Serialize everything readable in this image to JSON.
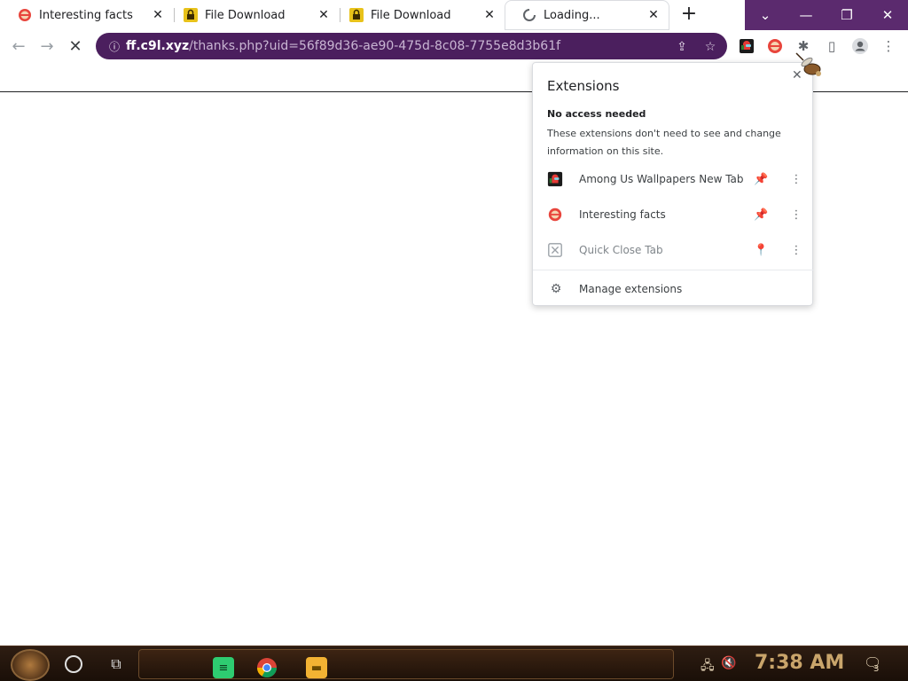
{
  "tabs": [
    {
      "title": "Interesting facts",
      "close": "✕"
    },
    {
      "title": "File Download",
      "close": "✕"
    },
    {
      "title": "File Download",
      "close": "✕"
    },
    {
      "title": "Loading...",
      "close": "✕"
    }
  ],
  "new_tab": "+",
  "window_controls": {
    "tab_search": "⌄",
    "minimize": "—",
    "restore": "❐",
    "close": "✕"
  },
  "toolbar": {
    "back": "←",
    "forward": "→",
    "stop": "✕",
    "url_host": "ff.c9l.xyz",
    "url_path": "/thanks.php?uid=56f89d36-ae90-475d-8c08-7755e8d3b61f",
    "share": "⇪",
    "bookmark": "☆",
    "extensions": "✱",
    "side_panel": "▯",
    "profile": "●",
    "menu": "⋮"
  },
  "extensions_popup": {
    "title": "Extensions",
    "close": "✕",
    "section_heading": "No access needed",
    "section_description": "These extensions don't need to see and change information on this site.",
    "items": [
      {
        "name": "Among Us Wallpapers New Tab",
        "pinned": true,
        "more": "⋮"
      },
      {
        "name": "Interesting facts",
        "pinned": true,
        "more": "⋮"
      },
      {
        "name": "Quick Close Tab",
        "pinned": false,
        "more": "⋮"
      }
    ],
    "manage_label": "Manage extensions"
  },
  "taskbar": {
    "clock": "7:38 AM",
    "notification_count": "3"
  },
  "colors": {
    "accent_purple": "#5b2a6e",
    "omnibox_bg": "#4b1f5e",
    "pin_blue": "#1a73e8",
    "taskbar_bg": "#1a0f08",
    "clock_gold": "#c9a56b"
  }
}
